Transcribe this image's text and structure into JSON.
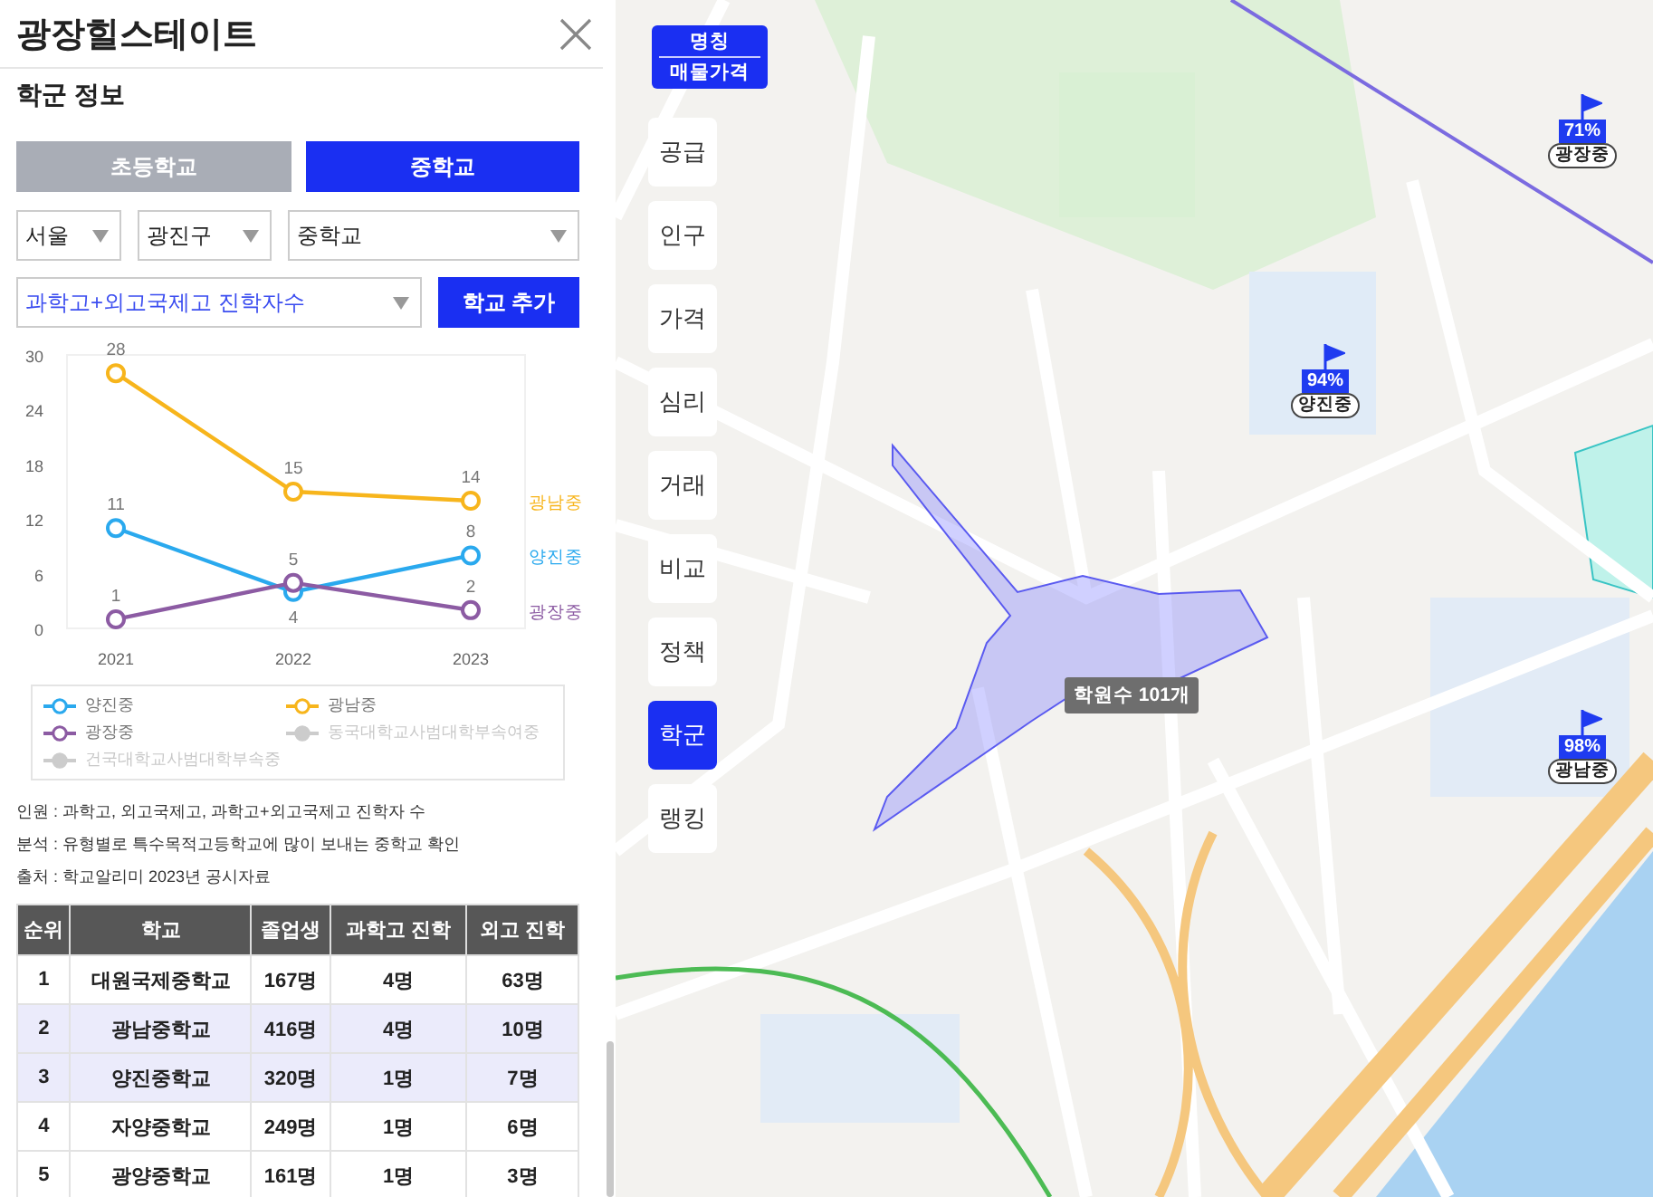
{
  "panel": {
    "title": "광장힐스테이트",
    "section_title": "학군 정보",
    "tabs": [
      {
        "label": "초등학교",
        "selected": false
      },
      {
        "label": "중학교",
        "selected": true
      }
    ],
    "filters": [
      {
        "value": "서울"
      },
      {
        "value": "광진구"
      },
      {
        "value": "중학교"
      }
    ],
    "metric_select": {
      "value": "과학고+외고국제고 진학자수"
    },
    "add_button": "학교 추가",
    "chart_data": {
      "type": "line",
      "categories": [
        "2021",
        "2022",
        "2023"
      ],
      "ylim": [
        0,
        30
      ],
      "yticks": [
        0,
        6,
        12,
        18,
        24,
        30
      ],
      "data_labels": true,
      "series": [
        {
          "name": "양진중",
          "color": "#2aa9ee",
          "marker": "circle",
          "values": [
            11,
            4,
            8
          ]
        },
        {
          "name": "광남중",
          "color": "#f7b51c",
          "marker": "circle",
          "values": [
            28,
            15,
            14
          ]
        },
        {
          "name": "광장중",
          "color": "#8c5ba3",
          "marker": "circle",
          "values": [
            1,
            5,
            2
          ]
        }
      ]
    },
    "legend": [
      {
        "label": "양진중",
        "color": "#2aa9ee",
        "disabled": false
      },
      {
        "label": "광남중",
        "color": "#f7b51c",
        "disabled": false
      },
      {
        "label": "광장중",
        "color": "#8c5ba3",
        "disabled": false
      },
      {
        "label": "동국대학교사범대학부속여중",
        "color": "#cccccc",
        "disabled": true
      },
      {
        "label": "건국대학교사범대학부속중",
        "color": "#cccccc",
        "disabled": true
      }
    ],
    "notes": [
      "인원 : 과학고, 외고국제고, 과학고+외고국제고 진학자 수",
      "분석 : 유형별로 특수목적고등학교에 많이 보내는 중학교 확인",
      "출처 : 학교알리미 2023년 공시자료"
    ],
    "table": {
      "columns": [
        "순위",
        "학교",
        "졸업생",
        "과학고 진학",
        "외고 진학"
      ],
      "rows": [
        {
          "cells": [
            "1",
            "대원국제중학교",
            "167명",
            "4명",
            "63명"
          ],
          "highlighted": false
        },
        {
          "cells": [
            "2",
            "광남중학교",
            "416명",
            "4명",
            "10명"
          ],
          "highlighted": true
        },
        {
          "cells": [
            "3",
            "양진중학교",
            "320명",
            "1명",
            "7명"
          ],
          "highlighted": true
        },
        {
          "cells": [
            "4",
            "자양중학교",
            "249명",
            "1명",
            "6명"
          ],
          "highlighted": false
        },
        {
          "cells": [
            "5",
            "광양중학교",
            "161명",
            "1명",
            "3명"
          ],
          "highlighted": false
        }
      ]
    }
  },
  "map": {
    "view_toggle": [
      "명칭",
      "매물가격"
    ],
    "menu": [
      {
        "label": "공급",
        "selected": false
      },
      {
        "label": "인구",
        "selected": false
      },
      {
        "label": "가격",
        "selected": false
      },
      {
        "label": "심리",
        "selected": false
      },
      {
        "label": "거래",
        "selected": false
      },
      {
        "label": "비교",
        "selected": false
      },
      {
        "label": "정책",
        "selected": false
      },
      {
        "label": "학군",
        "selected": true
      },
      {
        "label": "랭킹",
        "selected": false
      }
    ],
    "academy_tooltip": "학원수 101개",
    "school_markers": [
      {
        "percent": "71%",
        "name": "광장중"
      },
      {
        "percent": "94%",
        "name": "양진중"
      },
      {
        "percent": "98%",
        "name": "광남중"
      }
    ]
  }
}
